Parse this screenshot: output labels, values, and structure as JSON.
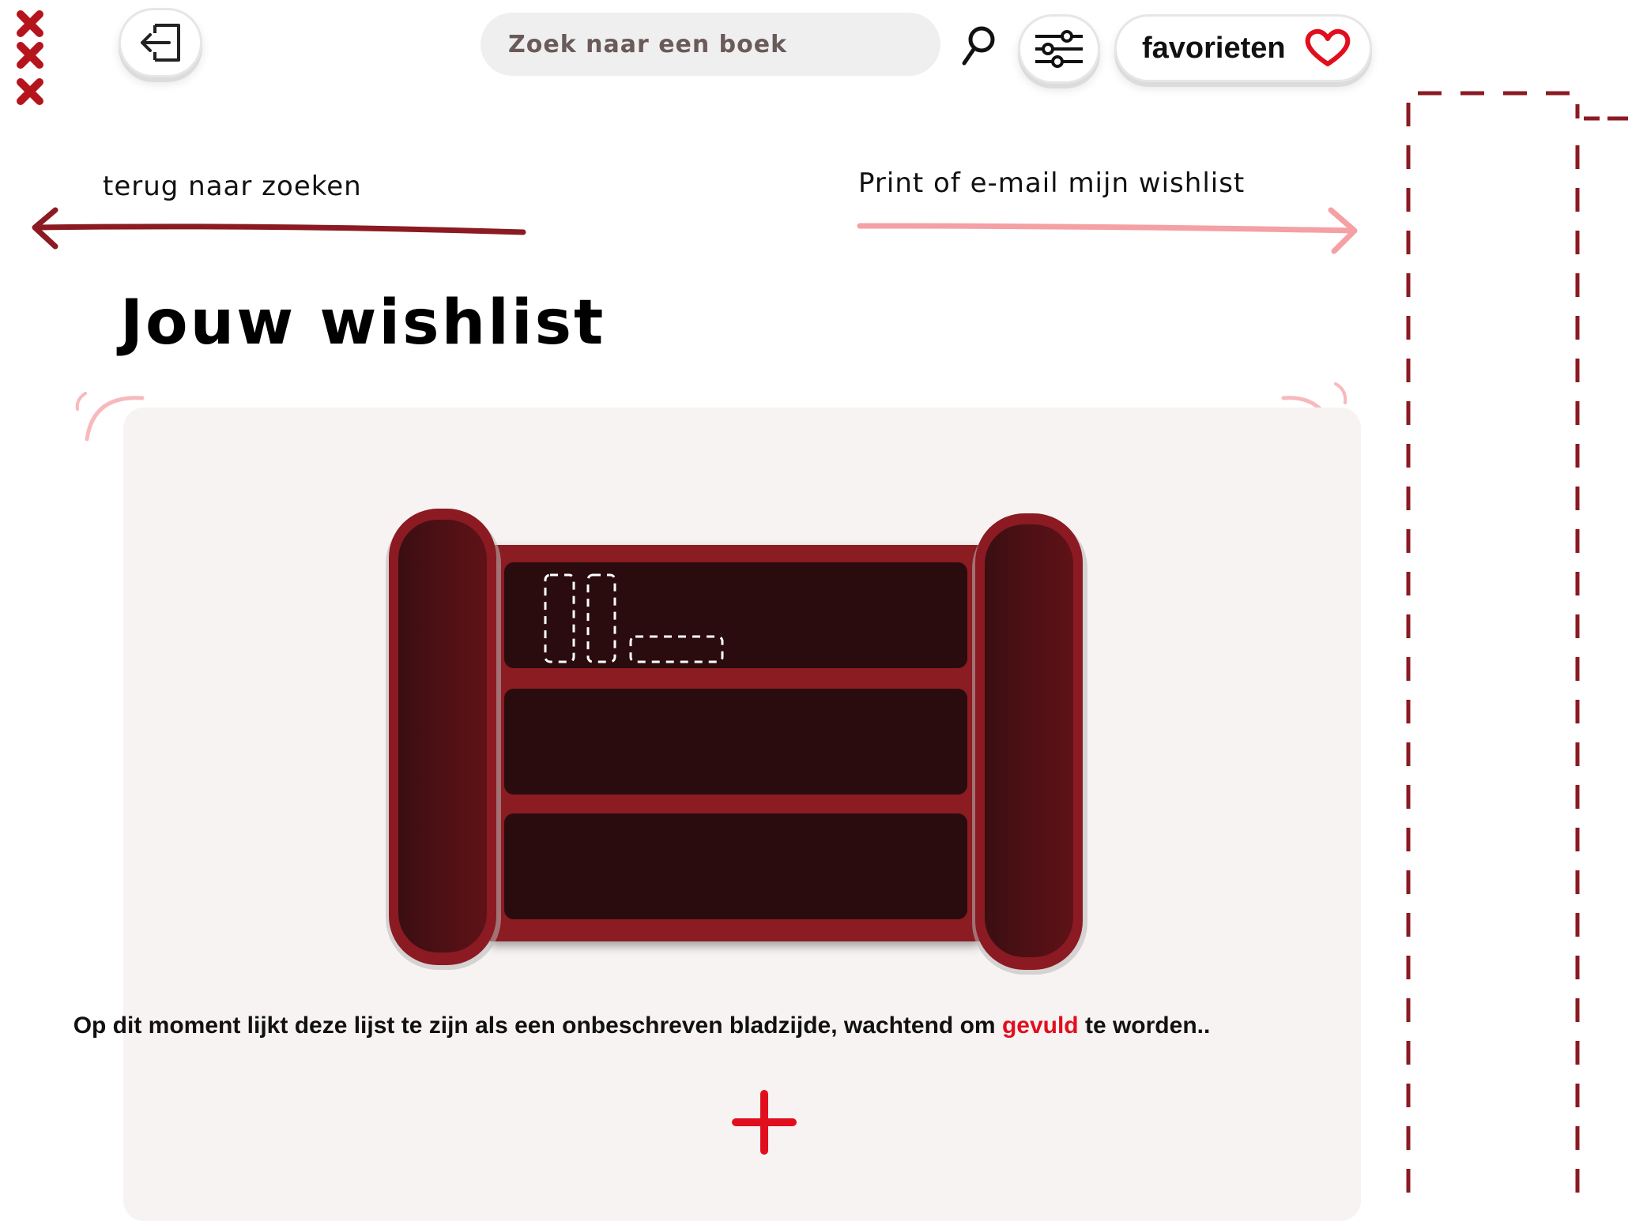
{
  "header": {
    "logo_marks": 3,
    "search": {
      "placeholder": "Zoek naar een boek",
      "value": ""
    },
    "favorites_label": "favorieten"
  },
  "nav": {
    "back_label": "terug naar zoeken",
    "print_label": "Print of e-mail mijn wishlist"
  },
  "page": {
    "title": "Jouw wishlist"
  },
  "empty_state": {
    "message_before": "Op dit moment lijkt deze lijst te zijn als een onbeschreven bladzijde, wachtend om ",
    "message_highlight": "gevuld",
    "message_after": " te worden.."
  },
  "colors": {
    "accent_red": "#e10f1e",
    "dark_red": "#8b1a22",
    "pink": "#f4a0a4",
    "panel_bg": "#f7f3f2",
    "shelf_bg": "#2a0c0e"
  },
  "icons": {
    "logout": "logout-icon",
    "search": "magnifier-icon",
    "filters": "sliders-icon",
    "favorites": "heart-icon",
    "add": "plus-icon"
  }
}
